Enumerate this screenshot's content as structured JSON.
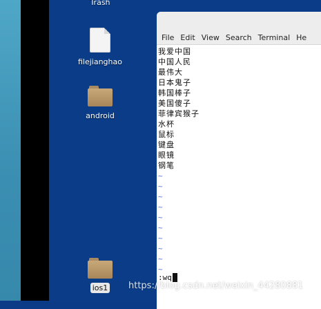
{
  "desktop": {
    "icons": [
      {
        "label": "Trash",
        "kind": "trash-icon",
        "selected": false
      },
      {
        "label": "filejianghao",
        "kind": "file-icon",
        "selected": false
      },
      {
        "label": "android",
        "kind": "folder-icon",
        "selected": false
      },
      {
        "label": "ios1",
        "kind": "folder-icon",
        "selected": true
      }
    ]
  },
  "terminal": {
    "menu": [
      "File",
      "Edit",
      "View",
      "Search",
      "Terminal",
      "He"
    ],
    "lines": [
      "我爱中国",
      "中国人民",
      "最伟大",
      "日本鬼子",
      "韩国棒子",
      "美国傻子",
      "菲律宾猴子",
      "水杯",
      "鼠标",
      "键盘",
      "眼镜",
      "钢笔"
    ],
    "tilde_rows": [
      "~",
      "~",
      "~",
      "~",
      "~",
      "~",
      "~",
      "~",
      "~",
      "~"
    ],
    "command": ":wq"
  },
  "watermark": "https://blog.csdn.net/weixin_44280881"
}
